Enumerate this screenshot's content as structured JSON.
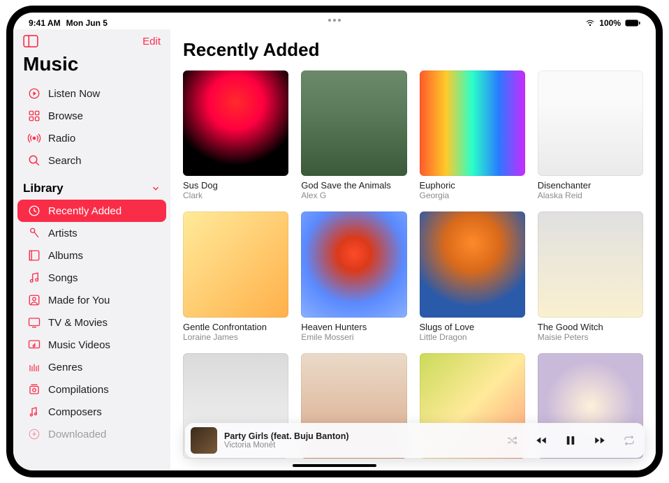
{
  "status": {
    "time": "9:41 AM",
    "date": "Mon Jun 5",
    "battery": "100%"
  },
  "sidebar": {
    "edit": "Edit",
    "app_title": "Music",
    "nav": [
      {
        "label": "Listen Now",
        "icon": "play-circle-icon"
      },
      {
        "label": "Browse",
        "icon": "grid-icon"
      },
      {
        "label": "Radio",
        "icon": "radio-icon"
      },
      {
        "label": "Search",
        "icon": "search-icon"
      }
    ],
    "library_header": "Library",
    "library": [
      {
        "label": "Recently Added",
        "icon": "clock-icon",
        "selected": true
      },
      {
        "label": "Artists",
        "icon": "mic-icon"
      },
      {
        "label": "Albums",
        "icon": "album-icon"
      },
      {
        "label": "Songs",
        "icon": "note-icon"
      },
      {
        "label": "Made for You",
        "icon": "person-badge-icon"
      },
      {
        "label": "TV & Movies",
        "icon": "tv-icon"
      },
      {
        "label": "Music Videos",
        "icon": "music-video-icon"
      },
      {
        "label": "Genres",
        "icon": "guitar-icon"
      },
      {
        "label": "Compilations",
        "icon": "compilation-icon"
      },
      {
        "label": "Composers",
        "icon": "composer-icon"
      },
      {
        "label": "Downloaded",
        "icon": "download-icon"
      }
    ]
  },
  "main": {
    "title": "Recently Added",
    "albums": [
      {
        "title": "Sus Dog",
        "artist": "Clark"
      },
      {
        "title": "God Save the Animals",
        "artist": "Alex G"
      },
      {
        "title": "Euphoric",
        "artist": "Georgia"
      },
      {
        "title": "Disenchanter",
        "artist": "Alaska Reid"
      },
      {
        "title": "Gentle Confrontation",
        "artist": "Loraine James"
      },
      {
        "title": "Heaven Hunters",
        "artist": "Emile Mosseri"
      },
      {
        "title": "Slugs of Love",
        "artist": "Little Dragon"
      },
      {
        "title": "The Good Witch",
        "artist": "Maisie Peters"
      },
      {
        "title": "",
        "artist": ""
      },
      {
        "title": "",
        "artist": ""
      },
      {
        "title": "",
        "artist": ""
      },
      {
        "title": "",
        "artist": ""
      }
    ]
  },
  "now_playing": {
    "title": "Party Girls (feat. Buju Banton)",
    "artist": "Victoria Monét"
  }
}
